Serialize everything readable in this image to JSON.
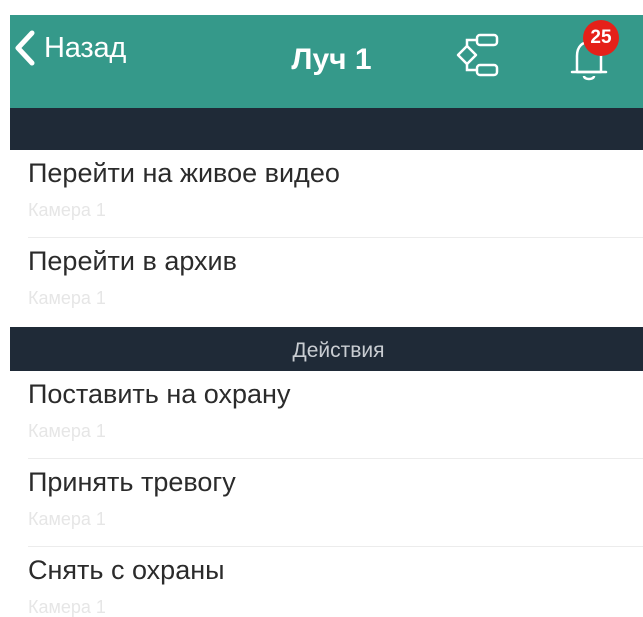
{
  "navbar": {
    "back_label": "Назад",
    "title": "Луч 1",
    "notifications_count": "25",
    "background_color": "#35998a",
    "badge_color": "#e52119",
    "icons": {
      "back": "chevron-left-icon",
      "tree": "hierarchy-tree-icon",
      "bell": "bell-icon"
    }
  },
  "sections": {
    "first_header": "",
    "actions_header": "Действия",
    "header_color": "#1f2a37"
  },
  "rows": [
    {
      "title": "Перейти на живое видео",
      "subtitle": "Камера 1"
    },
    {
      "title": "Перейти в архив",
      "subtitle": "Камера 1"
    },
    {
      "title": "Поставить на охрану",
      "subtitle": "Камера 1"
    },
    {
      "title": "Принять тревогу",
      "subtitle": "Камера 1"
    },
    {
      "title": "Снять с охраны",
      "subtitle": "Камера 1"
    }
  ]
}
